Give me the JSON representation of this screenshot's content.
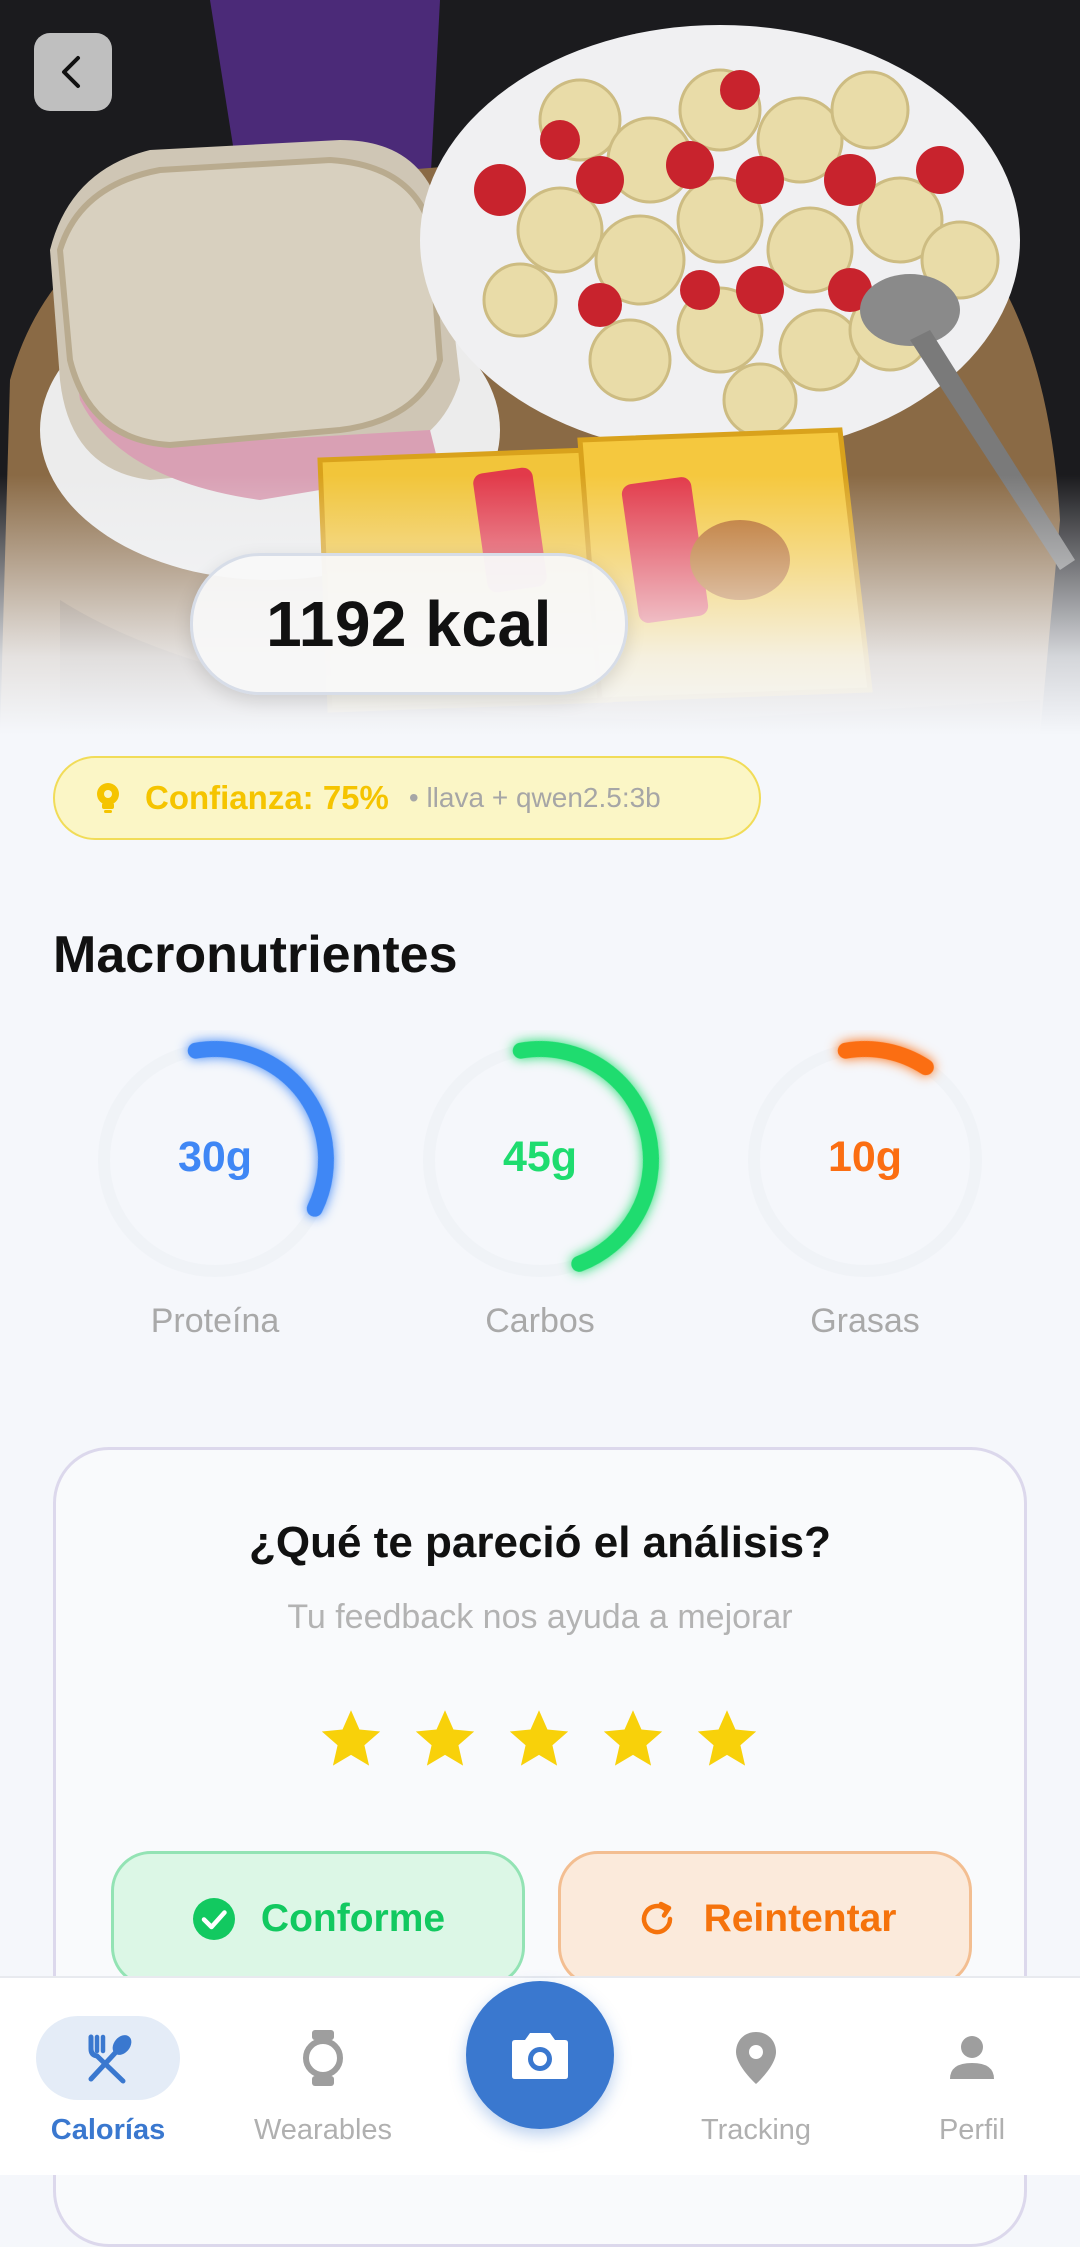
{
  "result": {
    "calories_text": "1192 kcal"
  },
  "confidence": {
    "label": "Confianza: 75%",
    "value": 0.75,
    "model": "• llava + qwen2.5:3b"
  },
  "macros": {
    "title": "Macronutrientes",
    "items": [
      {
        "value": "30g",
        "label": "Proteína",
        "color": "#3f87f5",
        "progress": 0.35
      },
      {
        "value": "45g",
        "label": "Carbos",
        "color": "#1fdc6f",
        "progress": 0.47
      },
      {
        "value": "10g",
        "label": "Grasas",
        "color": "#fb6e12",
        "progress": 0.12
      }
    ]
  },
  "feedback": {
    "question": "¿Qué te pareció el análisis?",
    "subtitle": "Tu feedback nos ayuda a mejorar",
    "rating": 5,
    "star_color": "#f8d10a",
    "ok_label": "Conforme",
    "retry_label": "Reintentar"
  },
  "nav": {
    "items": [
      {
        "label": "Calorías",
        "icon": "fork-spoon-icon",
        "active": true
      },
      {
        "label": "Wearables",
        "icon": "watch-icon",
        "active": false
      },
      {
        "label": "Tracking",
        "icon": "location-pin-icon",
        "active": false
      },
      {
        "label": "Perfil",
        "icon": "person-icon",
        "active": false
      }
    ],
    "center_icon": "camera-icon",
    "accent": "#3a78cf"
  }
}
